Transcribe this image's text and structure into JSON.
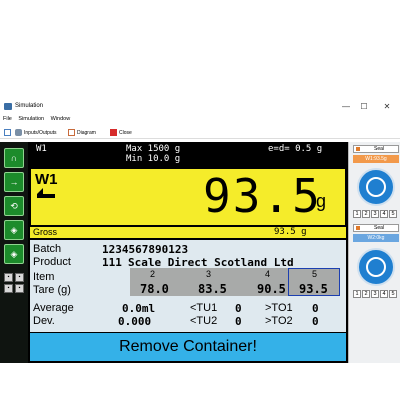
{
  "window": {
    "title": "Simulation",
    "controls": [
      "—",
      "☐",
      "✕"
    ]
  },
  "menu": [
    "File",
    "Simulation",
    "Window"
  ],
  "toolbar": {
    "inputs_outputs": "Inputs/Outputs",
    "diagram": "Diagram",
    "close": "Close"
  },
  "header": {
    "scale": "W1",
    "max": "Max 1500 g",
    "min": "Min 10.0 g",
    "e": "e=d= 0.5 g"
  },
  "display": {
    "scale": "W1",
    "weight": "93.5",
    "unit": "g"
  },
  "gross": {
    "label": "Gross",
    "value": "93.5 g"
  },
  "batch": {
    "label": "Batch",
    "value": "1234567890123"
  },
  "product": {
    "label": "Product",
    "code": "111",
    "name": "Scale Direct Scotland Ltd"
  },
  "items": {
    "label": "Item",
    "tare_label": "Tare (g)",
    "numbers": [
      "2",
      "3",
      "4",
      "5"
    ],
    "tares": [
      "78.0",
      "83.5",
      "90.5",
      "93.5"
    ],
    "selected": 3
  },
  "stats": {
    "average_label": "Average",
    "average_value": "0.0ml",
    "dev_label": "Dev.",
    "dev_value": "0.000",
    "tu1_label": "<TU1",
    "tu1_value": "0",
    "tu2_label": "<TU2",
    "tu2_value": "0",
    "to1_label": ">TO1",
    "to1_value": "0",
    "to2_label": ">TO2",
    "to2_value": "0"
  },
  "message": "Remove Container!",
  "right_panel": {
    "seal_label": "Seal",
    "w1_chip": "W1:93.5g",
    "w2_chip": "W2:0kg",
    "buttons": [
      "1",
      "2",
      "3",
      "4",
      "5"
    ]
  },
  "colors": {
    "display_yellow": "#f5ec2a",
    "message_blue": "#34b1e8",
    "green_button": "#1c8b2b",
    "chip_orange": "#f2994a",
    "chip_blue": "#6aa6e0"
  }
}
